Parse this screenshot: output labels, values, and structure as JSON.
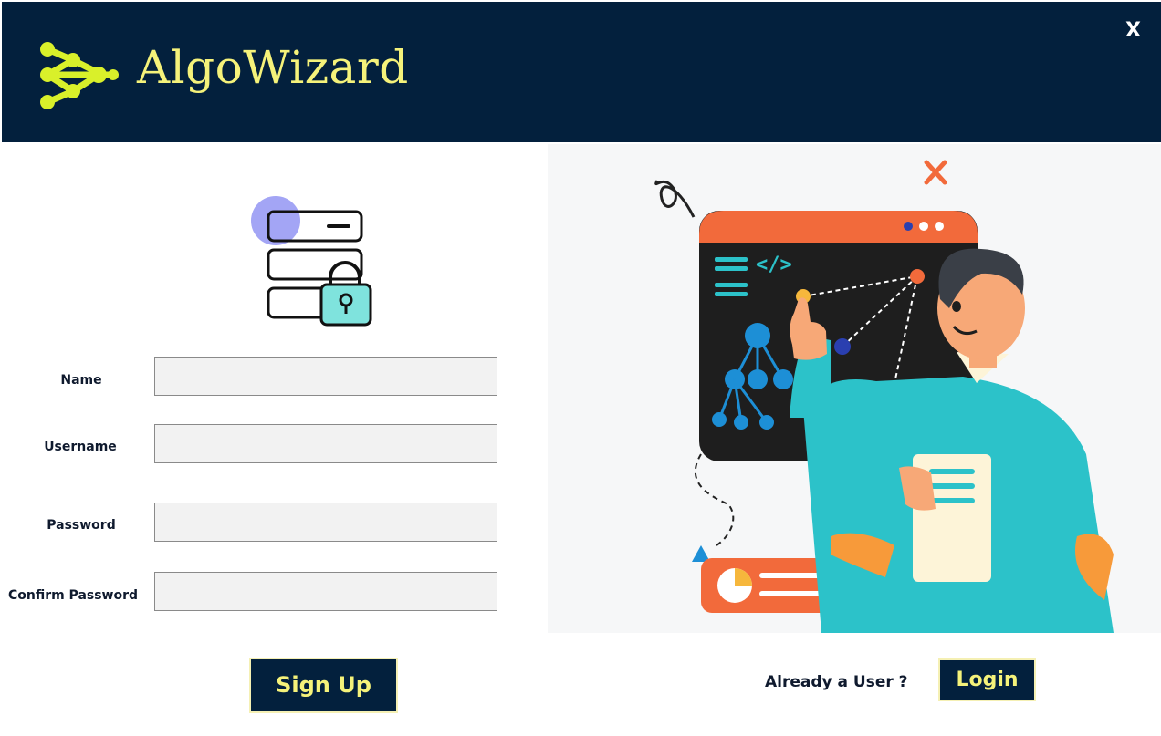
{
  "app": {
    "title": "AlgoWizard",
    "close_label": "X"
  },
  "form": {
    "fields": [
      {
        "label": "Name",
        "value": "",
        "placeholder": ""
      },
      {
        "label": "Username",
        "value": "",
        "placeholder": ""
      },
      {
        "label": "Password",
        "value": "",
        "placeholder": ""
      },
      {
        "label": "Confirm Password",
        "value": "",
        "placeholder": ""
      }
    ],
    "signup_label": "Sign Up"
  },
  "login_prompt": {
    "text": "Already a User ?",
    "login_label": "Login"
  },
  "colors": {
    "header_bg": "#03203d",
    "title_yellow": "#f5f27a",
    "logo_green": "#d9f02a",
    "screen_orange": "#f26a3b",
    "teal": "#2cc2c9"
  },
  "icons": {
    "logo": "network-nodes-icon",
    "lock_graphic": "server-lock-icon",
    "close": "close-icon"
  }
}
